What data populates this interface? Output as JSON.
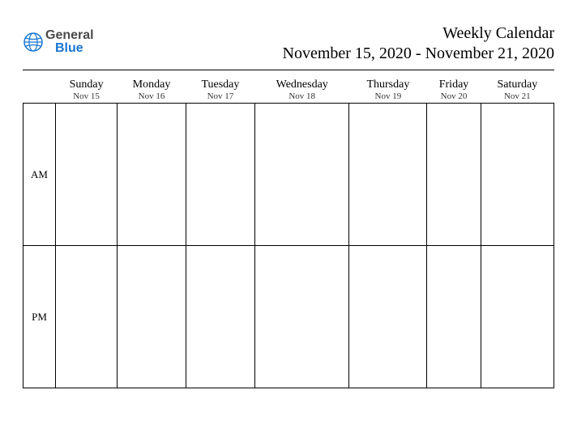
{
  "logo": {
    "line1": "General",
    "line2": "Blue"
  },
  "header": {
    "title": "Weekly Calendar",
    "date_range": "November 15, 2020 - November 21, 2020"
  },
  "days": [
    {
      "name": "Sunday",
      "date": "Nov 15"
    },
    {
      "name": "Monday",
      "date": "Nov 16"
    },
    {
      "name": "Tuesday",
      "date": "Nov 17"
    },
    {
      "name": "Wednesday",
      "date": "Nov 18"
    },
    {
      "name": "Thursday",
      "date": "Nov 19"
    },
    {
      "name": "Friday",
      "date": "Nov 20"
    },
    {
      "name": "Saturday",
      "date": "Nov 21"
    }
  ],
  "periods": {
    "am": "AM",
    "pm": "PM"
  }
}
